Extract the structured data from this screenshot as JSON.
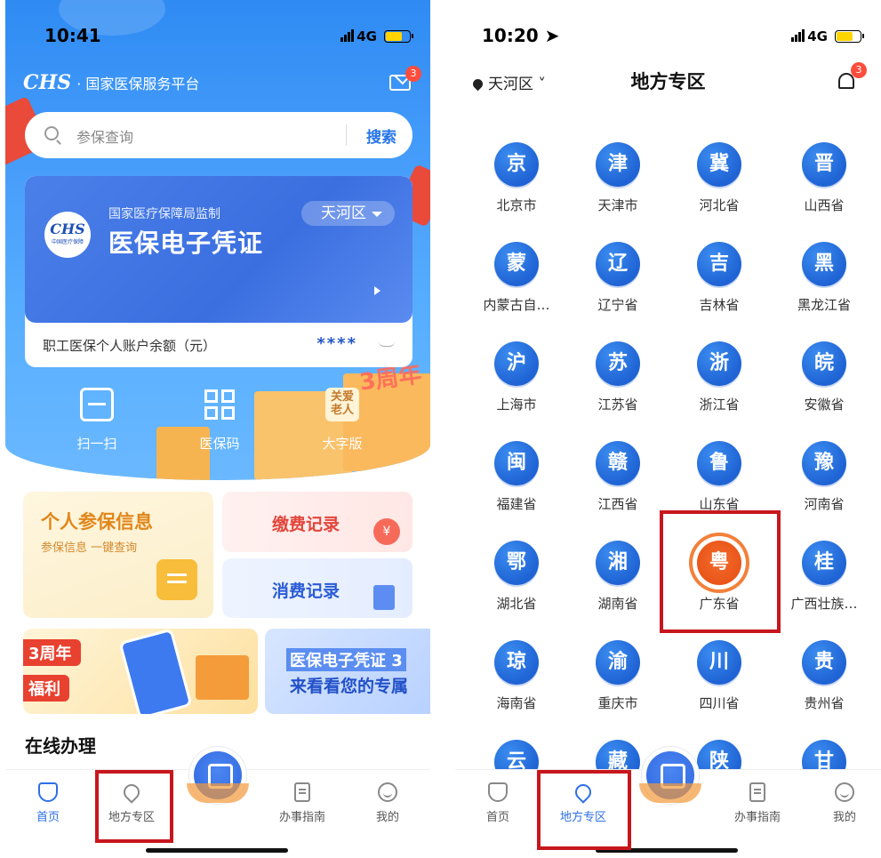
{
  "left": {
    "status": {
      "time": "10:41",
      "network": "4G"
    },
    "brand": {
      "logo": "CHS",
      "name": "· 国家医保服务平台"
    },
    "mail_badge": "3",
    "search": {
      "placeholder": "参保查询",
      "button": "搜索"
    },
    "card": {
      "logo": "CHS",
      "logo_sub": "中国医疗保障",
      "supervisor": "国家医疗保障局监制",
      "title": "医保电子凭证",
      "region": "天河区",
      "balance_label": "职工医保个人账户余额（元）",
      "balance_mask": "****"
    },
    "quick": [
      {
        "label": "扫一扫",
        "icon": "scan-icon"
      },
      {
        "label": "医保码",
        "icon": "qr-code-icon"
      },
      {
        "label": "大字版",
        "icon": "elder-care-icon",
        "icon_text": "关爱老人"
      }
    ],
    "anniversary": "3周年",
    "tiles": {
      "insurance_info": {
        "title": "个人参保信息",
        "subtitle": "参保信息 一键查询"
      },
      "payment": {
        "title": "缴费记录"
      },
      "consumption": {
        "title": "消费记录"
      }
    },
    "banner1": {
      "line1": "3周年",
      "line2": "福利"
    },
    "banner2": {
      "line1": "医保电子凭证 3",
      "line2": "来看看您的专属"
    },
    "section": "在线办理",
    "tabs": [
      {
        "label": "首页",
        "icon": "home-shield-icon",
        "active": true
      },
      {
        "label": "地方专区",
        "icon": "location-pin-icon",
        "active": false
      },
      {
        "label": "办事指南",
        "icon": "guide-doc-icon",
        "active": false
      },
      {
        "label": "我的",
        "icon": "profile-face-icon",
        "active": false
      }
    ]
  },
  "right": {
    "status": {
      "time": "10:20",
      "network": "4G"
    },
    "location": "天河区",
    "title": "地方专区",
    "bell_badge": "3",
    "provinces": [
      {
        "char": "京",
        "name": "北京市"
      },
      {
        "char": "津",
        "name": "天津市"
      },
      {
        "char": "冀",
        "name": "河北省"
      },
      {
        "char": "晋",
        "name": "山西省"
      },
      {
        "char": "蒙",
        "name": "内蒙古自…"
      },
      {
        "char": "辽",
        "name": "辽宁省"
      },
      {
        "char": "吉",
        "name": "吉林省"
      },
      {
        "char": "黑",
        "name": "黑龙江省"
      },
      {
        "char": "沪",
        "name": "上海市"
      },
      {
        "char": "苏",
        "name": "江苏省"
      },
      {
        "char": "浙",
        "name": "浙江省"
      },
      {
        "char": "皖",
        "name": "安徽省"
      },
      {
        "char": "闽",
        "name": "福建省"
      },
      {
        "char": "赣",
        "name": "江西省"
      },
      {
        "char": "鲁",
        "name": "山东省"
      },
      {
        "char": "豫",
        "name": "河南省"
      },
      {
        "char": "鄂",
        "name": "湖北省"
      },
      {
        "char": "湘",
        "name": "湖南省"
      },
      {
        "char": "粤",
        "name": "广东省",
        "highlight": true
      },
      {
        "char": "桂",
        "name": "广西壮族…"
      },
      {
        "char": "琼",
        "name": "海南省"
      },
      {
        "char": "渝",
        "name": "重庆市"
      },
      {
        "char": "川",
        "name": "四川省"
      },
      {
        "char": "贵",
        "name": "贵州省"
      },
      {
        "char": "云",
        "name": ""
      },
      {
        "char": "藏",
        "name": ""
      },
      {
        "char": "陕",
        "name": ""
      },
      {
        "char": "甘",
        "name": ""
      }
    ],
    "tabs": [
      {
        "label": "首页",
        "icon": "home-shield-icon",
        "active": false
      },
      {
        "label": "地方专区",
        "icon": "location-pin-icon",
        "active": true
      },
      {
        "label": "办事指南",
        "icon": "guide-doc-icon",
        "active": false
      },
      {
        "label": "我的",
        "icon": "profile-face-icon",
        "active": false
      }
    ]
  },
  "colors": {
    "accent": "#2d6fe7",
    "highlight_border": "#c8161d",
    "guangdong": "#ea5519"
  }
}
